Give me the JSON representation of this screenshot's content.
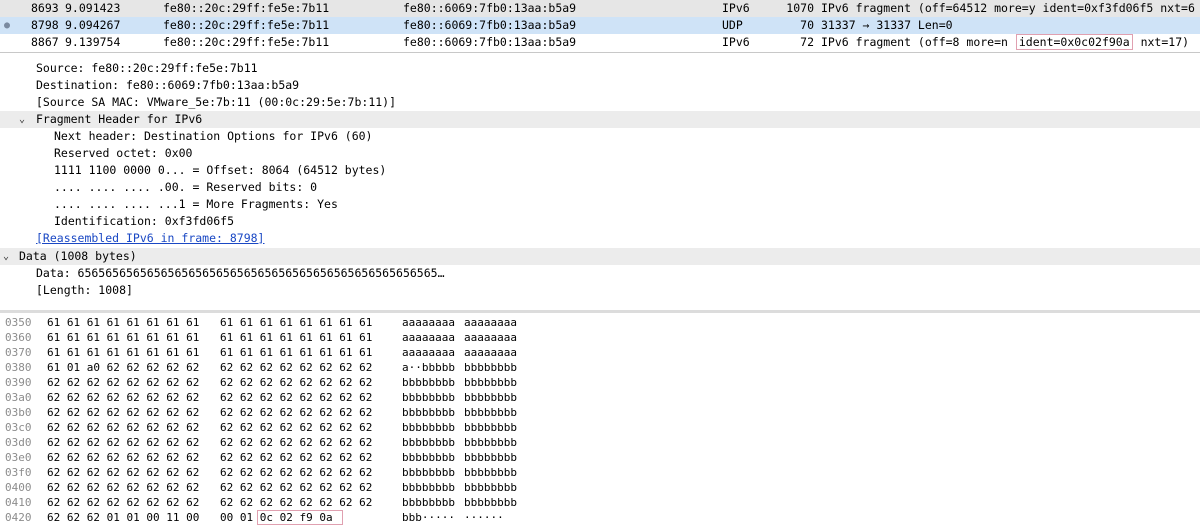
{
  "packet_list": {
    "rows": [
      {
        "no": "8693",
        "time": "9.091423",
        "src": "fe80::20c:29ff:fe5e:7b11",
        "dst": "fe80::6069:7fb0:13aa:b5a9",
        "proto": "IPv6",
        "len": "1070",
        "info": "IPv6 fragment (off=64512 more=y ident=0xf3fd06f5 nxt=6"
      },
      {
        "no": "8798",
        "time": "9.094267",
        "src": "fe80::20c:29ff:fe5e:7b11",
        "dst": "fe80::6069:7fb0:13aa:b5a9",
        "proto": "UDP",
        "len": "70",
        "info": "31337 → 31337 Len=0"
      },
      {
        "no": "8867",
        "time": "9.139754",
        "src": "fe80::20c:29ff:fe5e:7b11",
        "dst": "fe80::6069:7fb0:13aa:b5a9",
        "proto": "IPv6",
        "len": "72",
        "info_pre": "IPv6 fragment (off=8 more=n ",
        "info_hl": "ident=0x0c02f90a",
        "info_post": " nxt=17)"
      }
    ],
    "selected_bullet": "●"
  },
  "details": {
    "source": "Source: fe80::20c:29ff:fe5e:7b11",
    "destination": "Destination: fe80::6069:7fb0:13aa:b5a9",
    "source_mac": "[Source SA MAC: VMware_5e:7b:11 (00:0c:29:5e:7b:11)]",
    "frag_header": "Fragment Header for IPv6",
    "next_header": "Next header: Destination Options for IPv6 (60)",
    "reserved_octet": "Reserved octet: 0x00",
    "offset": "1111 1100 0000 0... = Offset: 8064 (64512 bytes)",
    "reserved_bits": ".... .... .... .00. = Reserved bits: 0",
    "more_frags": ".... .... .... ...1 = More Fragments: Yes",
    "identification": "Identification: 0xf3fd06f5",
    "reassembled": "[Reassembled IPv6 in frame: 8798]",
    "data_header": "Data (1008 bytes)",
    "data_value": "Data: 6565656565656565656565656565656565656565656565656565…",
    "data_length": "[Length: 1008]",
    "expand_glyph": "⌄"
  },
  "hex_dump": {
    "rows": [
      {
        "off": "0350",
        "h1": "61 61 61 61 61 61 61 61",
        "h2": "61 61 61 61 61 61 61 61",
        "a1": "aaaaaaaa",
        "a2": "aaaaaaaa"
      },
      {
        "off": "0360",
        "h1": "61 61 61 61 61 61 61 61",
        "h2": "61 61 61 61 61 61 61 61",
        "a1": "aaaaaaaa",
        "a2": "aaaaaaaa"
      },
      {
        "off": "0370",
        "h1": "61 61 61 61 61 61 61 61",
        "h2": "61 61 61 61 61 61 61 61",
        "a1": "aaaaaaaa",
        "a2": "aaaaaaaa"
      },
      {
        "off": "0380",
        "h1": "61 01 a0 62 62 62 62 62",
        "h2": "62 62 62 62 62 62 62 62",
        "a1": "a··bbbbb",
        "a2": "bbbbbbbb"
      },
      {
        "off": "0390",
        "h1": "62 62 62 62 62 62 62 62",
        "h2": "62 62 62 62 62 62 62 62",
        "a1": "bbbbbbbb",
        "a2": "bbbbbbbb"
      },
      {
        "off": "03a0",
        "h1": "62 62 62 62 62 62 62 62",
        "h2": "62 62 62 62 62 62 62 62",
        "a1": "bbbbbbbb",
        "a2": "bbbbbbbb"
      },
      {
        "off": "03b0",
        "h1": "62 62 62 62 62 62 62 62",
        "h2": "62 62 62 62 62 62 62 62",
        "a1": "bbbbbbbb",
        "a2": "bbbbbbbb"
      },
      {
        "off": "03c0",
        "h1": "62 62 62 62 62 62 62 62",
        "h2": "62 62 62 62 62 62 62 62",
        "a1": "bbbbbbbb",
        "a2": "bbbbbbbb"
      },
      {
        "off": "03d0",
        "h1": "62 62 62 62 62 62 62 62",
        "h2": "62 62 62 62 62 62 62 62",
        "a1": "bbbbbbbb",
        "a2": "bbbbbbbb"
      },
      {
        "off": "03e0",
        "h1": "62 62 62 62 62 62 62 62",
        "h2": "62 62 62 62 62 62 62 62",
        "a1": "bbbbbbbb",
        "a2": "bbbbbbbb"
      },
      {
        "off": "03f0",
        "h1": "62 62 62 62 62 62 62 62",
        "h2": "62 62 62 62 62 62 62 62",
        "a1": "bbbbbbbb",
        "a2": "bbbbbbbb"
      },
      {
        "off": "0400",
        "h1": "62 62 62 62 62 62 62 62",
        "h2": "62 62 62 62 62 62 62 62",
        "a1": "bbbbbbbb",
        "a2": "bbbbbbbb"
      },
      {
        "off": "0410",
        "h1": "62 62 62 62 62 62 62 62",
        "h2": "62 62 62 62 62 62 62 62",
        "a1": "bbbbbbbb",
        "a2": "bbbbbbbb"
      },
      {
        "off": "0420",
        "h1": "62 62 62 01 01 00 11 00",
        "h2": "00 01 0c 02 f9 0a",
        "a1": "bbb·····",
        "a2": "······"
      }
    ]
  }
}
